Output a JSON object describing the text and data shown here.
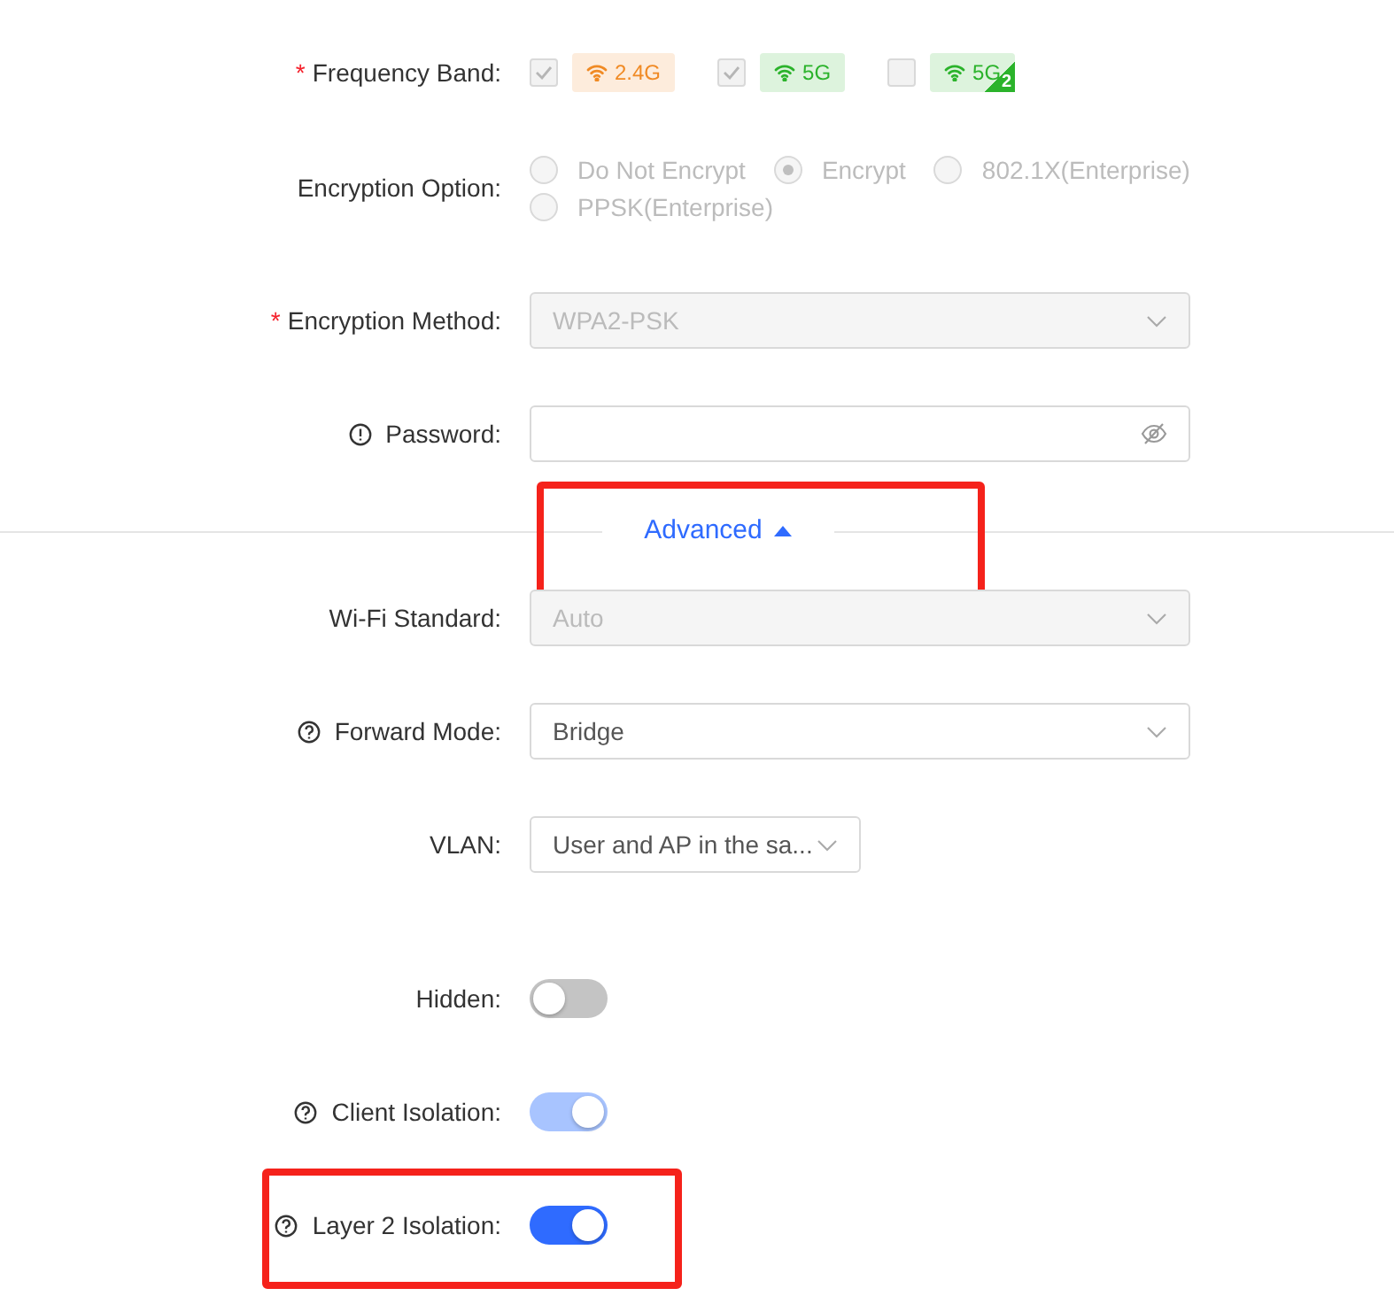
{
  "fields": [
    {
      "kind": "checkbox-group",
      "label": "Frequency Band:",
      "required_mark": "*",
      "options": [
        {
          "label": "2.4G",
          "checked": true,
          "disabled": true,
          "color": "#f08a24"
        },
        {
          "label": "5G",
          "checked": true,
          "disabled": true,
          "color": "#2bb32b"
        },
        {
          "label": "5G",
          "corner": "2",
          "checked": false,
          "disabled": true,
          "color": "#2bb32b"
        }
      ]
    },
    {
      "kind": "radio-group",
      "label": "Encryption Option:",
      "options": [
        {
          "label": "Do Not Encrypt",
          "selected": false,
          "disabled": true
        },
        {
          "label": "Encrypt",
          "selected": true,
          "disabled": true
        },
        {
          "label": "802.1X(Enterprise)",
          "selected": false,
          "disabled": true
        },
        {
          "label": "PPSK(Enterprise)",
          "selected": false,
          "disabled": true
        }
      ]
    },
    {
      "kind": "select",
      "label": "Encryption Method:",
      "required_mark": "*",
      "value": "WPA2-PSK",
      "disabled": true
    },
    {
      "kind": "password",
      "label": "Password:",
      "hint": {
        "kind": "info"
      }
    },
    {
      "kind": "section-toggle",
      "label": "Advanced",
      "expanded": true,
      "highlighted": true
    },
    {
      "kind": "select",
      "label": "Wi-Fi Standard:",
      "value": "Auto",
      "disabled": true
    },
    {
      "kind": "select",
      "label": "Forward Mode:",
      "hint": {
        "kind": "question"
      },
      "value": "Bridge",
      "disabled": false
    },
    {
      "kind": "short-select",
      "label": "VLAN:",
      "value": "User and AP in the sa...",
      "disabled": false
    },
    {
      "kind": "switch",
      "label": "Hidden:",
      "on": false
    },
    {
      "kind": "switch",
      "label": "Client Isolation:",
      "hint": {
        "kind": "question"
      },
      "on": true,
      "disabled": true
    },
    {
      "kind": "switch",
      "label": "Layer 2 Isolation:",
      "hint": {
        "kind": "question"
      },
      "on": true,
      "disabled": false,
      "highlighted": true
    }
  ]
}
